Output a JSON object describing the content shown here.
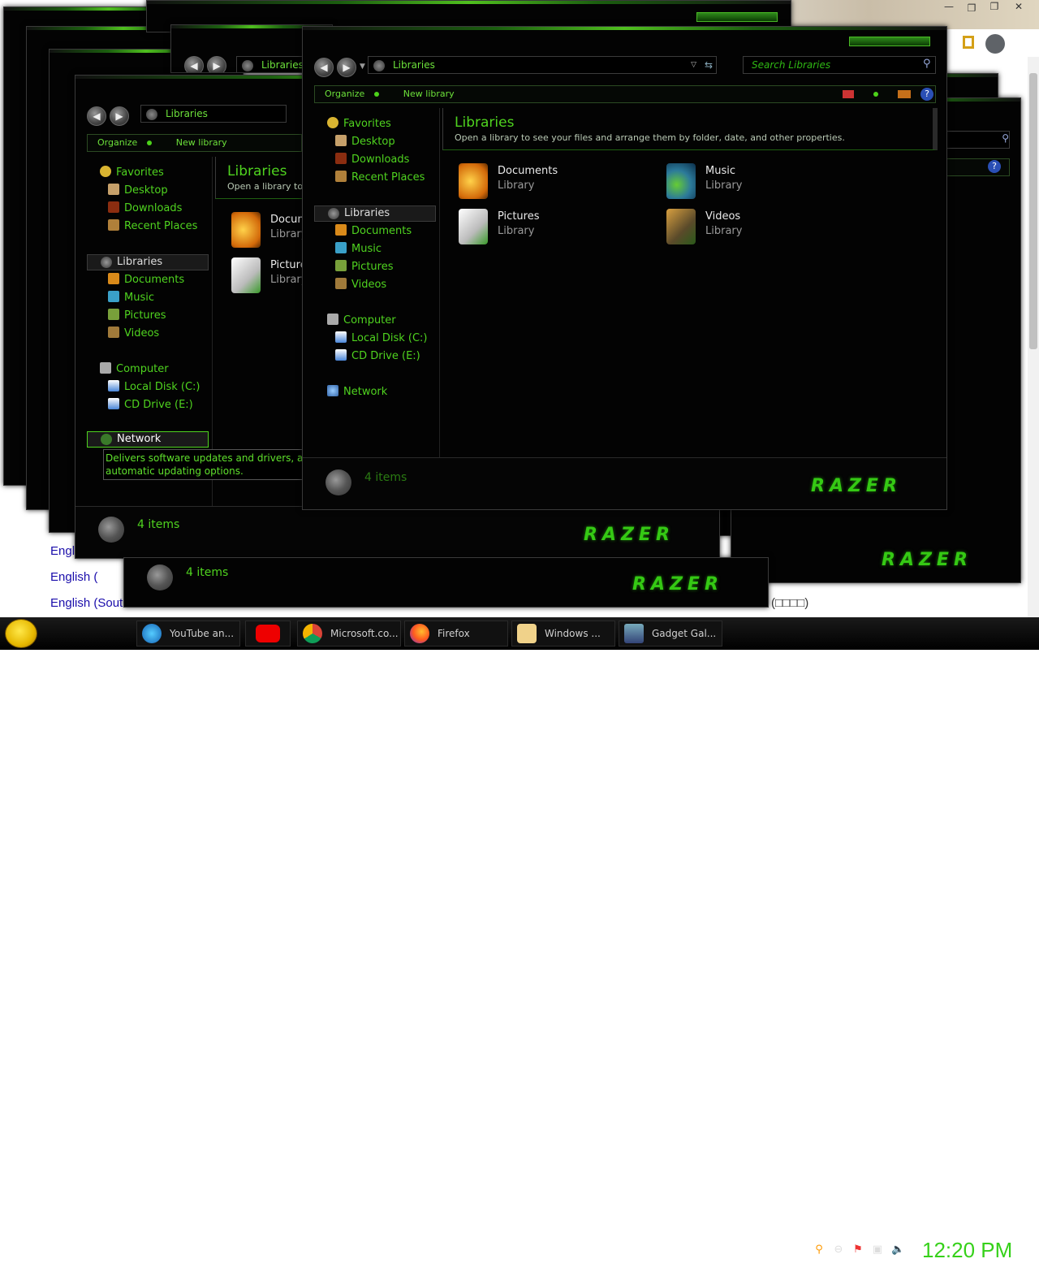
{
  "background_page": {
    "lines": [
      "Engl",
      "English (",
      "English (Sout"
    ],
    "right_text": "(□□□□)"
  },
  "explorer": {
    "address_label": "Libraries",
    "search_placeholder": "Search Libraries",
    "toolbar": {
      "organize": "Organize",
      "new_library": "New library"
    },
    "nav": {
      "favorites": "Favorites",
      "desktop": "Desktop",
      "downloads": "Downloads",
      "recent_places": "Recent Places",
      "libraries": "Libraries",
      "documents": "Documents",
      "music": "Music",
      "pictures": "Pictures",
      "videos": "Videos",
      "computer": "Computer",
      "local_disk": "Local Disk (C:)",
      "cd_drive": "CD Drive (E:)",
      "network": "Network"
    },
    "content": {
      "title": "Libraries",
      "description": "Open a library to see your files and arrange them by folder, date, and other properties.",
      "description_cut": "Open a library to se",
      "items": [
        {
          "name": "Documents",
          "short": "Docum",
          "type": "Library"
        },
        {
          "name": "Music",
          "type": "Library"
        },
        {
          "name": "Pictures",
          "short": "Picture",
          "type": "Library"
        },
        {
          "name": "Videos",
          "type": "Library"
        }
      ]
    },
    "status": "4 items",
    "status_cut": "4 items",
    "brand": "RAZER",
    "tooltip": "Delivers software updates and drivers, and provides automatic updating options."
  },
  "taskbar": {
    "items": [
      {
        "label": "YouTube an...",
        "icon": "edge-icon"
      },
      {
        "label": "",
        "icon": "youtube-icon"
      },
      {
        "label": "Microsoft.co...",
        "icon": "chrome-icon"
      },
      {
        "label": "Firefox",
        "icon": "firefox-icon"
      },
      {
        "label": "Windows ...",
        "icon": "folder-icon"
      },
      {
        "label": "Gadget Gal...",
        "icon": "gadget-icon"
      }
    ],
    "clock": "12:20 PM"
  }
}
